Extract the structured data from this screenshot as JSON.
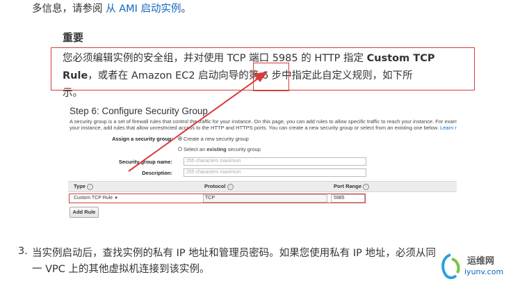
{
  "top_line": {
    "text": "多信息，请参阅",
    "link": "从 AMI 启动实例",
    "end": "。"
  },
  "important": {
    "heading": "重要",
    "line1_pre": "您必须编辑实例的安全组，并对使用 TCP 端口 5985 的 HTTP 指定 ",
    "line1_bold": "Custom TCP",
    "line2_bold": "Rule",
    "line2_rest": "，或者在 Amazon EC2 启动向导的第 6 步中指定此自定义规则，如下所",
    "line3": "示。"
  },
  "console": {
    "step_title": "Step 6: Configure Security Group",
    "desc_line1": "A security group is a set of firewall rules that control the traffic for your instance. On this page, you can add rules to allow specific traffic to reach your instance. For example, if",
    "desc_line2_pre": "your instance, add rules that allow unrestricted access to the HTTP and HTTPS ports. You can create a new security group or select from an existing one below. ",
    "desc_link": "Learn more",
    "assign_label": "Assign a security group:",
    "radio_create": "Create a new security group",
    "radio_select_pre": "Select an ",
    "radio_select_bold": "existing",
    "radio_select_post": " security group",
    "sg_name_label": "Security group name:",
    "sg_name_placeholder": "255 characters maximum",
    "desc_label": "Description:",
    "desc_placeholder": "255 characters maximum",
    "col_type": "Type",
    "col_protocol": "Protocol",
    "col_port": "Port Range",
    "row_type": "Custom TCP Rule",
    "row_protocol": "TCP",
    "row_port": "5985",
    "add_rule": "Add Rule"
  },
  "step3": {
    "num": "3.",
    "line1": "当实例启动后，查找实例的私有 IP 地址和管理员密码。如果您使用私有 IP 地址，必须从同",
    "line2": "一 VPC 上的其他虚拟机连接到该实例。"
  },
  "watermark": {
    "title": "运维网",
    "domain": "iyunv.com"
  },
  "colors": {
    "annotation_red": "#d93a3a",
    "link_blue": "#1166bb"
  }
}
